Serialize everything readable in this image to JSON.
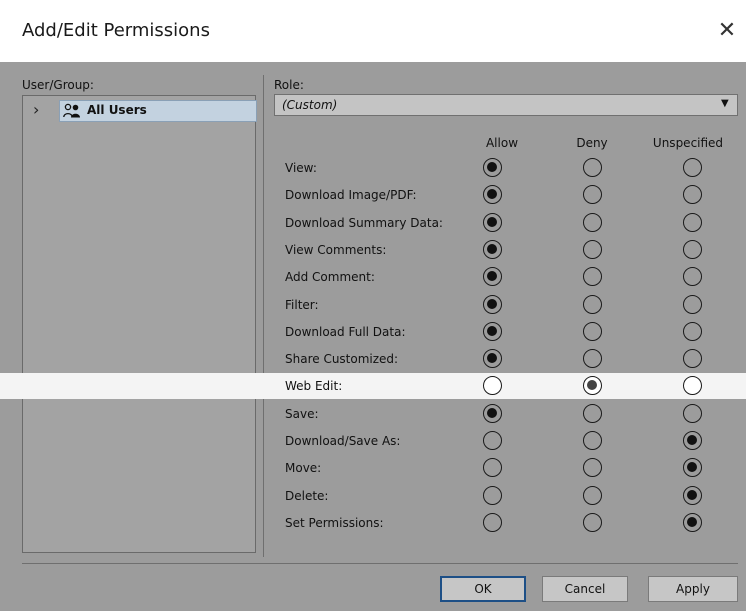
{
  "dialog": {
    "title": "Add/Edit Permissions",
    "close_glyph": "✕"
  },
  "user_group": {
    "label": "User/Group:",
    "items": [
      {
        "expand_glyph": "›",
        "icon": "users-icon",
        "name": "All Users",
        "selected": true
      }
    ]
  },
  "role": {
    "label": "Role:",
    "value": "(Custom)",
    "dropdown_glyph": "▼"
  },
  "columns": [
    "Allow",
    "Deny",
    "Unspecified"
  ],
  "permissions": [
    {
      "label": "View:",
      "choice": "Allow",
      "highlighted": false
    },
    {
      "label": "Download Image/PDF:",
      "choice": "Allow",
      "highlighted": false
    },
    {
      "label": "Download Summary Data:",
      "choice": "Allow",
      "highlighted": false
    },
    {
      "label": "View Comments:",
      "choice": "Allow",
      "highlighted": false
    },
    {
      "label": "Add Comment:",
      "choice": "Allow",
      "highlighted": false
    },
    {
      "label": "Filter:",
      "choice": "Allow",
      "highlighted": false
    },
    {
      "label": "Download Full Data:",
      "choice": "Allow",
      "highlighted": false
    },
    {
      "label": "Share Customized:",
      "choice": "Allow",
      "highlighted": false
    },
    {
      "label": "Web Edit:",
      "choice": "Deny",
      "highlighted": true
    },
    {
      "label": "Save:",
      "choice": "Allow",
      "highlighted": false
    },
    {
      "label": "Download/Save As:",
      "choice": "Unspecified",
      "highlighted": false
    },
    {
      "label": "Move:",
      "choice": "Unspecified",
      "highlighted": false
    },
    {
      "label": "Delete:",
      "choice": "Unspecified",
      "highlighted": false
    },
    {
      "label": "Set Permissions:",
      "choice": "Unspecified",
      "highlighted": false
    }
  ],
  "buttons": {
    "ok": "OK",
    "cancel": "Cancel",
    "apply": "Apply"
  },
  "colors": {
    "panel": "#9c9c9c",
    "selection": "#c3d2e0",
    "highlight_row": "#f4f4f4",
    "ok_border": "#1d4f86"
  }
}
